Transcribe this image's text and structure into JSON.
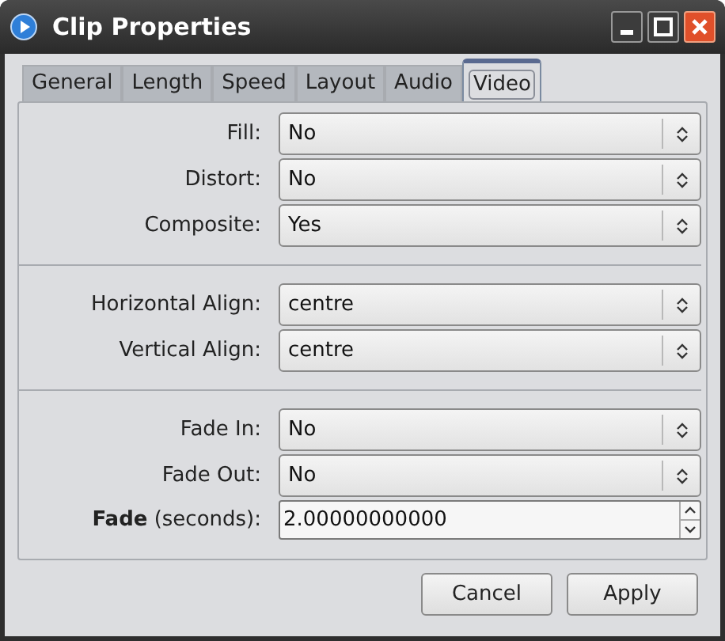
{
  "window": {
    "title": "Clip Properties"
  },
  "tabs": [
    {
      "label": "General",
      "selected": false
    },
    {
      "label": "Length",
      "selected": false
    },
    {
      "label": "Speed",
      "selected": false
    },
    {
      "label": "Layout",
      "selected": false
    },
    {
      "label": "Audio",
      "selected": false
    },
    {
      "label": "Video",
      "selected": true
    }
  ],
  "sections": [
    {
      "rows": [
        {
          "kind": "combo",
          "label": "Fill:",
          "value": "No"
        },
        {
          "kind": "combo",
          "label": "Distort:",
          "value": "No"
        },
        {
          "kind": "combo",
          "label": "Composite:",
          "value": "Yes"
        }
      ]
    },
    {
      "rows": [
        {
          "kind": "combo",
          "label": "Horizontal Align:",
          "value": "centre"
        },
        {
          "kind": "combo",
          "label": "Vertical Align:",
          "value": "centre"
        }
      ]
    },
    {
      "rows": [
        {
          "kind": "combo",
          "label": "Fade In:",
          "value": "No"
        },
        {
          "kind": "combo",
          "label": "Fade Out:",
          "value": "No"
        },
        {
          "kind": "spin",
          "label": "**Fade** (seconds):",
          "value": "2.00000000000"
        }
      ]
    }
  ],
  "buttons": [
    "Cancel",
    "Apply"
  ]
}
